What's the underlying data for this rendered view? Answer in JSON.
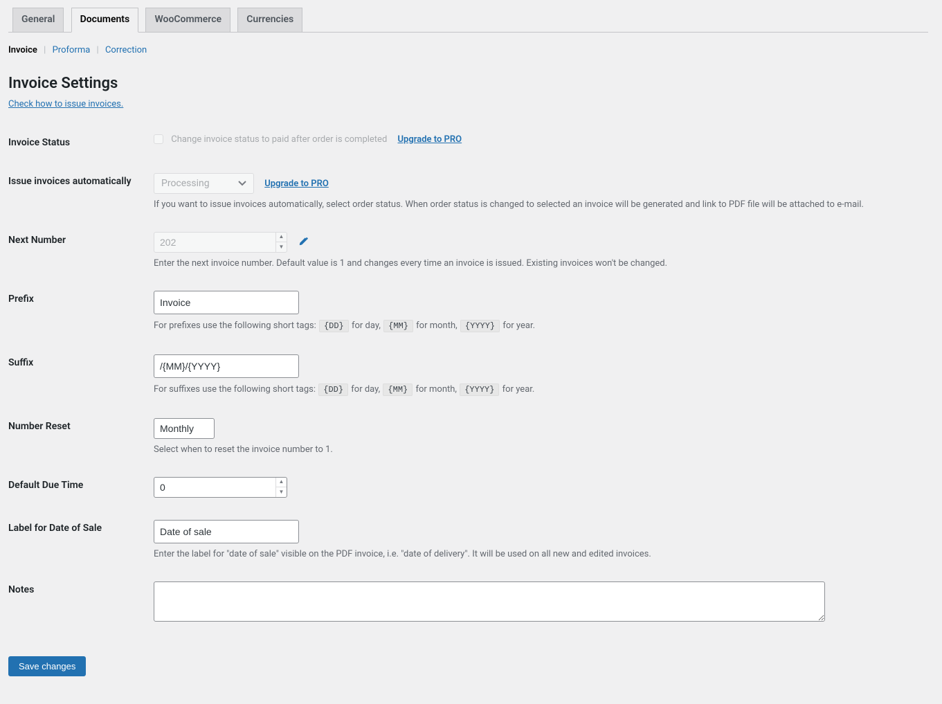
{
  "tabs": {
    "general": "General",
    "documents": "Documents",
    "woocommerce": "WooCommerce",
    "currencies": "Currencies"
  },
  "subtabs": {
    "invoice": "Invoice",
    "proforma": "Proforma",
    "correction": "Correction"
  },
  "page_title": "Invoice Settings",
  "help_link": "Check how to issue invoices.",
  "upgrade": "Upgrade to PRO",
  "labels": {
    "invoice_status": "Invoice Status",
    "issue_auto": "Issue invoices automatically",
    "next_number": "Next Number",
    "prefix": "Prefix",
    "suffix": "Suffix",
    "number_reset": "Number Reset",
    "default_due": "Default Due Time",
    "label_date_sale": "Label for Date of Sale",
    "notes": "Notes"
  },
  "fields": {
    "invoice_status_checkbox_label": "Change invoice status to paid after order is completed",
    "issue_auto_value": "Processing",
    "issue_auto_desc": "If you want to issue invoices automatically, select order status. When order status is changed to selected an invoice will be generated and link to PDF file will be attached to e-mail.",
    "next_number_value": "202",
    "next_number_desc": "Enter the next invoice number. Default value is 1 and changes every time an invoice is issued. Existing invoices won't be changed.",
    "prefix_value": "Invoice",
    "prefix_desc_pre": "For prefixes use the following short tags: ",
    "suffix_value": "/{MM}/{YYYY}",
    "suffix_desc_pre": "For suffixes use the following short tags: ",
    "tag_dd": "{DD}",
    "tag_mm": "{MM}",
    "tag_yyyy": "{YYYY}",
    "for_day": " for day, ",
    "for_month": " for month, ",
    "for_year": " for year.",
    "number_reset_value": "Monthly",
    "number_reset_desc": "Select when to reset the invoice number to 1.",
    "default_due_value": "0",
    "label_date_sale_value": "Date of sale",
    "label_date_sale_desc": "Enter the label for \"date of sale\" visible on the PDF invoice, i.e. \"date of delivery\". It will be used on all new and edited invoices.",
    "notes_value": ""
  },
  "save_button": "Save changes"
}
